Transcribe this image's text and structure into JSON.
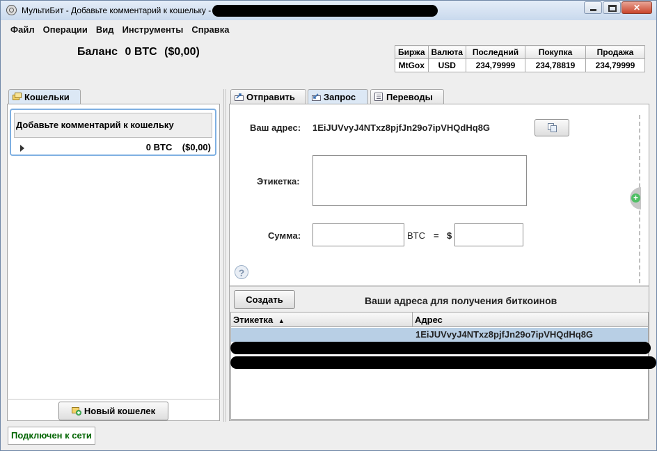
{
  "window": {
    "title": "МультиБит - Добавьте комментарий к кошельку -"
  },
  "menu": {
    "items": [
      "Файл",
      "Операции",
      "Вид",
      "Инструменты",
      "Справка"
    ]
  },
  "balance": {
    "label": "Баланс",
    "btc": "0 BTC",
    "fiat": "($0,00)"
  },
  "ticker": {
    "headers": [
      "Биржа",
      "Валюта",
      "Последний",
      "Покупка",
      "Продажа"
    ],
    "row": [
      "MtGox",
      "USD",
      "234,79999",
      "234,78819",
      "234,79999"
    ]
  },
  "wallets": {
    "tab_label": "Кошельки",
    "wallet": {
      "name": "Добавьте комментарий к кошельку",
      "btc": "0 BTC",
      "fiat": "($0,00)"
    },
    "new_wallet_label": "Новый кошелек"
  },
  "tabs": [
    {
      "label": "Отправить",
      "icon": "send-icon"
    },
    {
      "label": "Запрос",
      "icon": "request-icon",
      "active": true
    },
    {
      "label": "Переводы",
      "icon": "transactions-icon"
    }
  ],
  "request": {
    "address_label": "Ваш адрес:",
    "address_value": "1EiJUVvyJ4NTxz8pjfJn29o7ipVHQdHq8G",
    "label_label": "Этикетка:",
    "label_value": "",
    "amount_label": "Сумма:",
    "btc_unit": "BTC",
    "equals": "=",
    "usd_symbol": "$",
    "amount_btc_value": "",
    "amount_usd_value": "",
    "help_glyph": "?"
  },
  "addresses": {
    "create_label": "Создать",
    "section_title": "Ваши адреса для получения биткоинов",
    "columns": [
      "Этикетка",
      "Адрес"
    ],
    "sort_indicator": "▲",
    "rows": [
      {
        "label": "",
        "address": "1EiJUVvyJ4NTxz8pjfJn29o7ipVHQdHq8G"
      }
    ]
  },
  "status": {
    "text": "Подключен к сети",
    "color": "#006400"
  },
  "colors": {
    "selection": "#b8cfe5",
    "focus_border": "#7fb0e2"
  }
}
